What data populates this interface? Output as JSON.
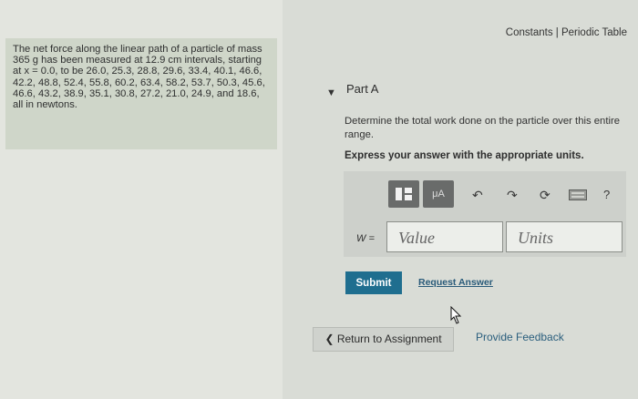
{
  "problem": {
    "text": "The net force along the linear path of a particle of mass 365 g has been measured at 12.9 cm intervals, starting at x = 0.0, to be 26.0, 25.3, 28.8, 29.6, 33.4, 40.1, 46.6, 42.2, 48.8, 52.4, 55.8, 60.2, 63.4, 58.2, 53.7, 50.3, 45.6, 46.6, 43.2, 38.9, 35.1, 30.8, 27.2, 21.0, 24.9, and 18.6, all in newtons."
  },
  "header": {
    "constants": "Constants",
    "separator": " | ",
    "periodic_table": "Periodic Table"
  },
  "part": {
    "toggle_glyph": "▼",
    "title": "Part A",
    "question": "Determine the total work done on the particle over this entire range.",
    "instruction": "Express your answer with the appropriate units."
  },
  "toolbar": {
    "templates_icon": "templates-icon",
    "units_button": "μA",
    "undo_icon": "undo-icon",
    "redo_icon": "redo-icon",
    "reset_icon": "reset-icon",
    "keyboard_icon": "keyboard-icon",
    "help": "?"
  },
  "answer": {
    "variable_label": "W =",
    "value_placeholder": "Value",
    "units_placeholder": "Units"
  },
  "actions": {
    "submit": "Submit",
    "request_answer": "Request Answer",
    "return": "Return to Assignment",
    "feedback": "Provide Feedback"
  },
  "colors": {
    "submit_bg": "#1f6e8f",
    "problem_bg": "#cfd6c9",
    "link": "#2a5b7a"
  }
}
